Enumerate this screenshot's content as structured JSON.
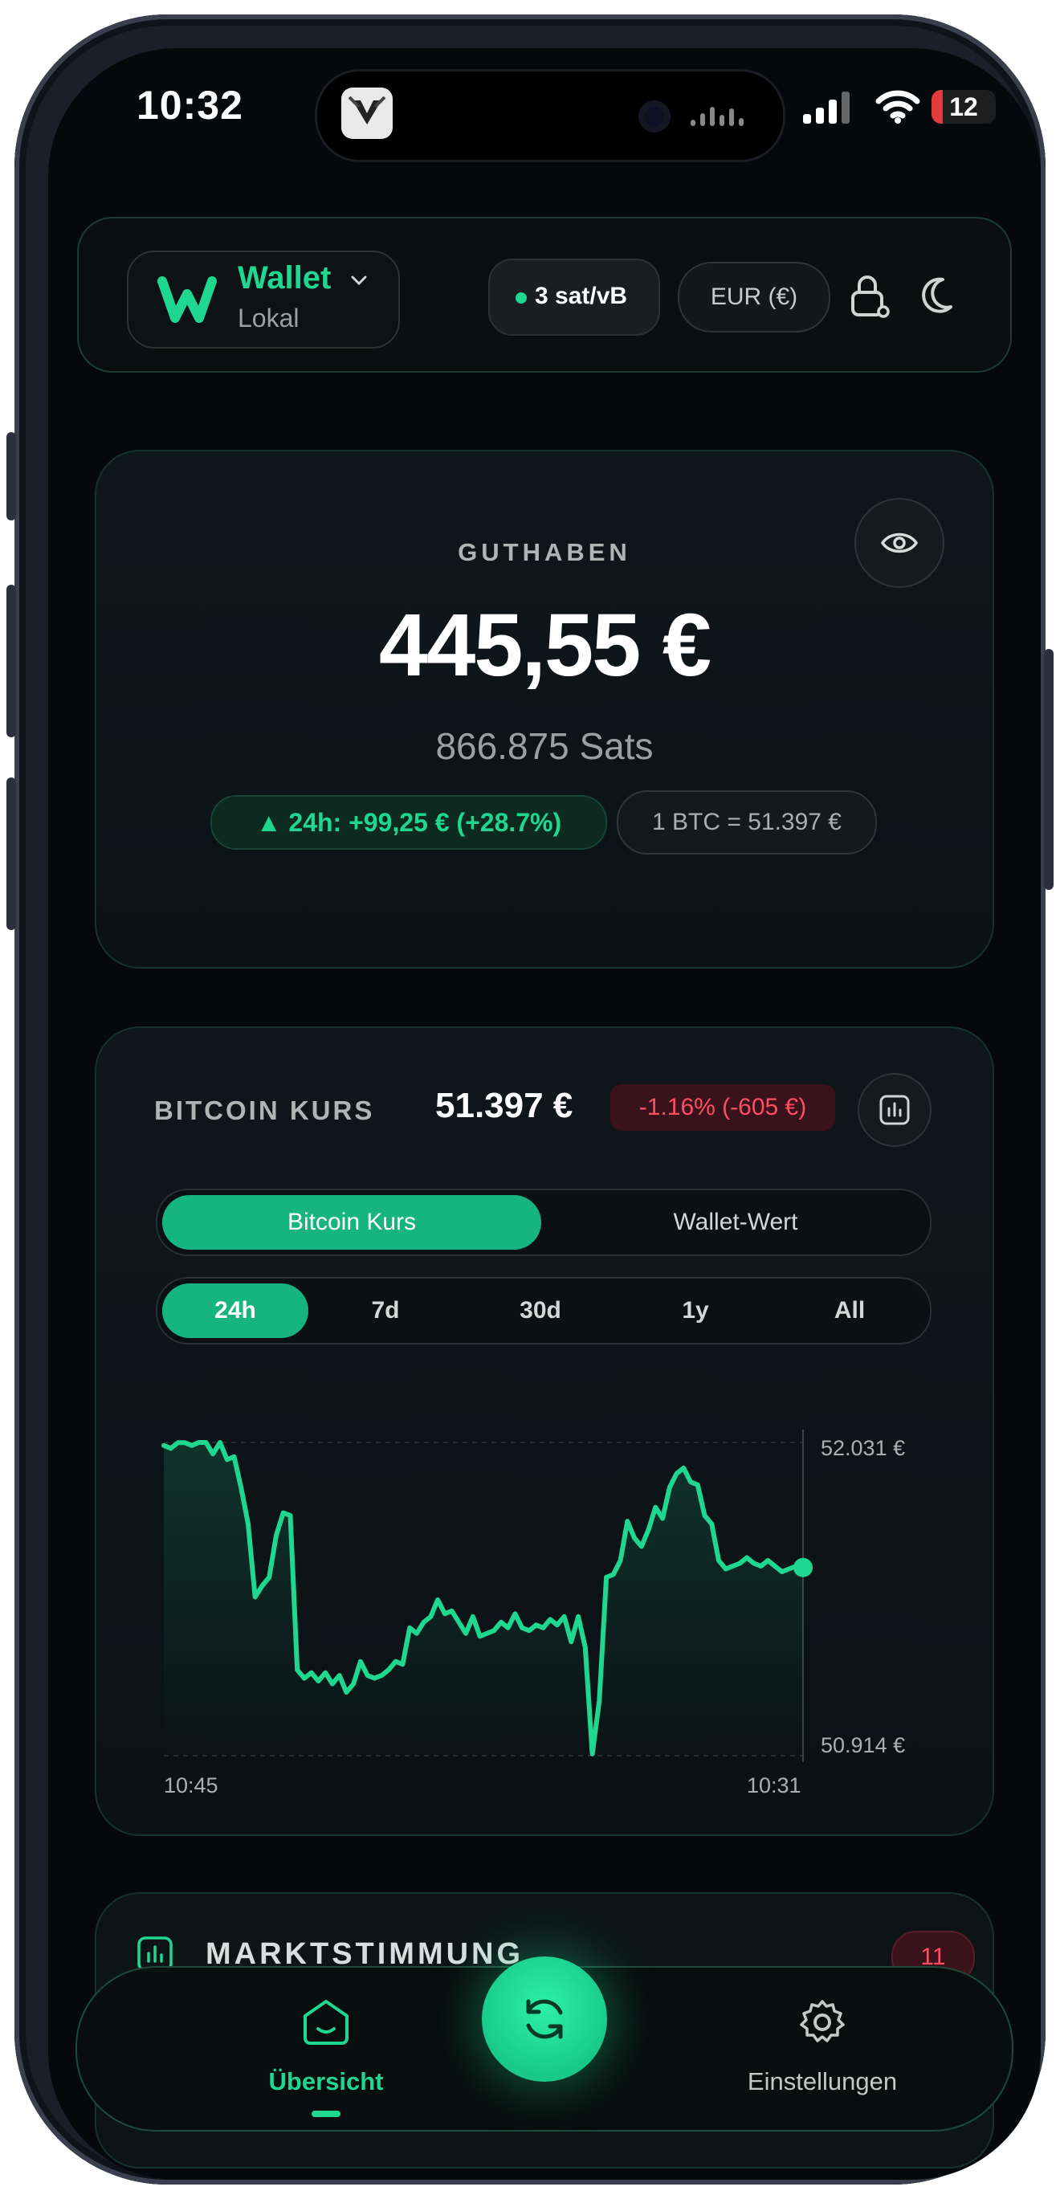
{
  "status_bar": {
    "time": "10:32",
    "battery": "12"
  },
  "header": {
    "wallet_name": "Wallet",
    "wallet_sub": "Lokal",
    "fee": "3 sat/vB",
    "currency": "EUR (€)",
    "icons": [
      "chevron-down-icon",
      "lock-icon",
      "moon-icon"
    ]
  },
  "balance": {
    "label": "GUTHABEN",
    "amount": "445,55 €",
    "sats": "866.875 Sats",
    "change_24h": "▲ 24h: +99,25 € (+28.7%)",
    "rate": "1 BTC = 51.397 €"
  },
  "chart": {
    "title": "BITCOIN KURS",
    "price": "51.397 €",
    "change": "-1.16% (-605 €)",
    "tabs": [
      "Bitcoin Kurs",
      "Wallet-Wert"
    ],
    "active_tab": "Bitcoin Kurs",
    "ranges": [
      "24h",
      "7d",
      "30d",
      "1y",
      "All"
    ],
    "active_range": "24h",
    "colors": {
      "accent": "#1fd791",
      "negative": "#ff4e62"
    }
  },
  "chart_data": {
    "type": "line",
    "title": "",
    "xlabel": "",
    "ylabel": "",
    "x_start": "10:45",
    "x_end": "10:31",
    "ylim": [
      50914,
      52031
    ],
    "y_tick_labels": [
      "52.031 €",
      "50.914 €"
    ],
    "series": [
      {
        "values": [
          52020,
          52010,
          52030,
          52030,
          52020,
          52031,
          52031,
          51990,
          52031,
          51970,
          51980,
          51870,
          51740,
          51480,
          51520,
          51550,
          51700,
          51780,
          51770,
          51220,
          51190,
          51210,
          51180,
          51210,
          51170,
          51200,
          51140,
          51170,
          51250,
          51200,
          51190,
          51200,
          51220,
          51250,
          51240,
          51370,
          51350,
          51390,
          51410,
          51470,
          51420,
          51430,
          51390,
          51350,
          51410,
          51340,
          51350,
          51360,
          51390,
          51370,
          51420,
          51370,
          51360,
          51380,
          51370,
          51400,
          51380,
          51410,
          51320,
          51410,
          51300,
          50920,
          51110,
          51550,
          51560,
          51610,
          51750,
          51690,
          51660,
          51720,
          51800,
          51760,
          51870,
          51920,
          51940,
          51890,
          51880,
          51770,
          51740,
          51610,
          51580,
          51590,
          51600,
          51620,
          51600,
          51590,
          51610,
          51590,
          51570,
          51580,
          51590,
          51585
        ]
      }
    ],
    "grid": false
  },
  "sentiment": {
    "title": "MARKTSTIMMUNG",
    "value": "11"
  },
  "bottom_nav": {
    "overview": "Übersicht",
    "settings": "Einstellungen"
  }
}
